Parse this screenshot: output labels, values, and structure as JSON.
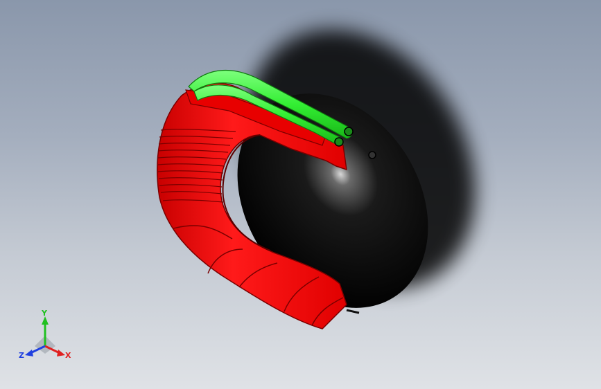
{
  "viewport": {
    "background_top": "#8a97ab",
    "background_bottom": "#dfe2e6"
  },
  "model": {
    "body_color": "#ff0000",
    "rail_color": "#2ee82e",
    "dome_color": "#0a0a0a"
  },
  "triad": {
    "x_label": "X",
    "y_label": "Y",
    "z_label": "Z",
    "x_color": "#e02020",
    "y_color": "#20c020",
    "z_color": "#2040e0"
  }
}
